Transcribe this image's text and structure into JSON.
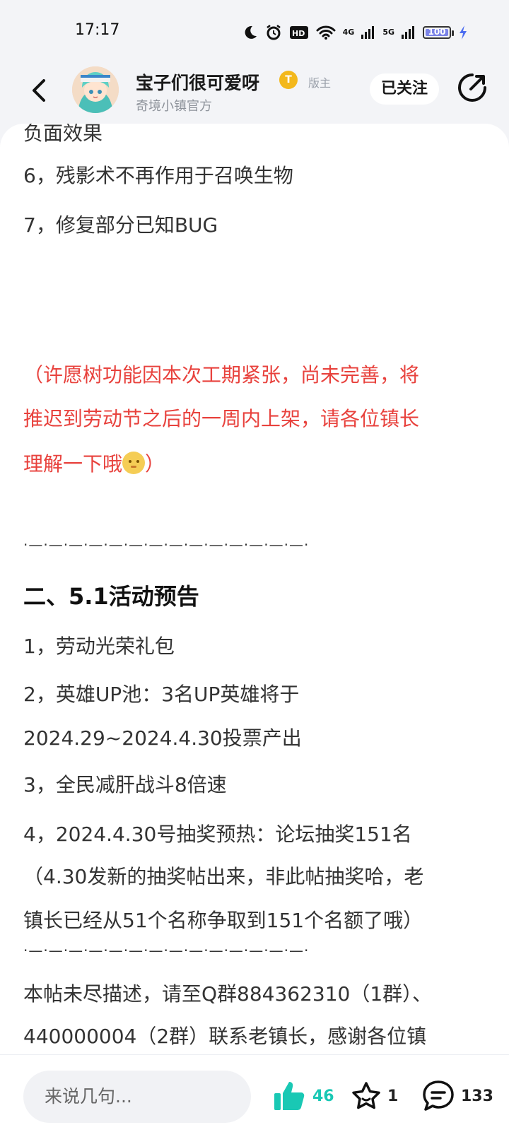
{
  "status_bar": {
    "time": "17:17",
    "network_1": "4G",
    "network_2": "5G",
    "battery": "100"
  },
  "header": {
    "author_name": "宝子们很可爱呀",
    "level_badge": "T",
    "role_tag": "版主",
    "author_subtitle": "奇境小镇官方",
    "follow_label": "已关注"
  },
  "content": {
    "lines": [
      "负面效果",
      "6，残影术不再作用于召唤生物",
      "7，修复部分已知BUG"
    ],
    "notice_lines": [
      "（许愿树功能因本次工期紧张，尚未完善，将",
      "推迟到劳动节之后的一周内上架，请各位镇长",
      "理解一下哦",
      "）"
    ],
    "divider": "·—·—·—·—·—·—·—·—·—·—·—·—·—·—·",
    "section_title": "二、5.1活动预告",
    "items": [
      "1，劳动光荣礼包",
      "2，英雄UP池：3名UP英雄将于",
      "2024.29~2024.4.30投票产出",
      "3，全民减肝战斗8倍速",
      "4，2024.4.30号抽奖预热：论坛抽奖151名",
      "（4.30发新的抽奖帖出来，非此帖抽奖哈，老",
      "镇长已经从51个名称争取到151个名额了哦）"
    ],
    "footer_lines": [
      "本帖未尽描述，请至Q群884362310（1群）、",
      "440000004（2群）联系老镇长，感谢各位镇"
    ]
  },
  "bottom_bar": {
    "comment_placeholder": "来说几句...",
    "like_count": "46",
    "favorite_count": "1",
    "comment_count": "133"
  },
  "colors": {
    "accent_teal": "#19c8b4",
    "notice_red": "#e8423d",
    "badge_gold": "#f3b81c"
  },
  "icons": [
    "moon-icon",
    "alarm-icon",
    "hd-icon",
    "wifi-icon",
    "signal-icon",
    "battery-icon",
    "charging-icon",
    "back-arrow-icon",
    "share-icon",
    "thumbs-up-icon",
    "star-icon",
    "comment-icon"
  ]
}
